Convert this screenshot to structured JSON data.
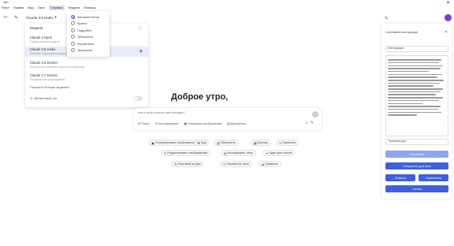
{
  "window": {
    "title": "Jan",
    "close_icon": "close-icon"
  },
  "menubar": [
    "Файл",
    "Правка",
    "Вид",
    "Окно",
    "Справка",
    "Модели",
    "Помощь"
  ],
  "toolbar": {
    "model_label": "Claude 3.5 Haiku"
  },
  "model_panel": {
    "title": "Модели",
    "items": [
      {
        "name": "Claude 3 Opus",
        "desc": "Самая мощная модель"
      },
      {
        "name": "Claude 3.5 Haiku",
        "desc": "Быстрая и доступная модель",
        "selected": true
      },
      {
        "name": "Claude 3.5 Sonnet",
        "desc": "Лучшее соотношение скорости и качества"
      },
      {
        "name": "Claude 3.7 Sonnet",
        "desc": "Продвинутые рассуждения"
      }
    ],
    "more": "Показать больше моделей",
    "temp_chat": "Временный чат"
  },
  "mode_menu": {
    "options": [
      "Автоматически",
      "Кратко",
      "Подробно",
      "Объяснить",
      "Формально",
      "Творчески"
    ]
  },
  "greeting": "Доброе утро,",
  "chat": {
    "placeholder": "Как я могу помочь вам сегодня?",
    "tools": [
      "Поиск",
      "Исследование",
      "Генерация изображений",
      "Документы"
    ]
  },
  "suggestions": [
    "Сгенерировать изображение",
    "Код",
    "Объяснить",
    "Анализ",
    "Написать",
    "Редактировать изображение",
    "Исследовать тему",
    "Идеи для текста",
    "Мозговой штурм",
    "Перевести текст",
    "Сравнить"
  ],
  "right_panel": {
    "title": "Системные инструкции",
    "field": "Инструкции",
    "sub": "Температура",
    "buttons": {
      "primary": "Сохранить",
      "save_all": "Сохранить для всех",
      "left": "Отмена",
      "right": "Применить",
      "bottom": "Готово"
    }
  }
}
